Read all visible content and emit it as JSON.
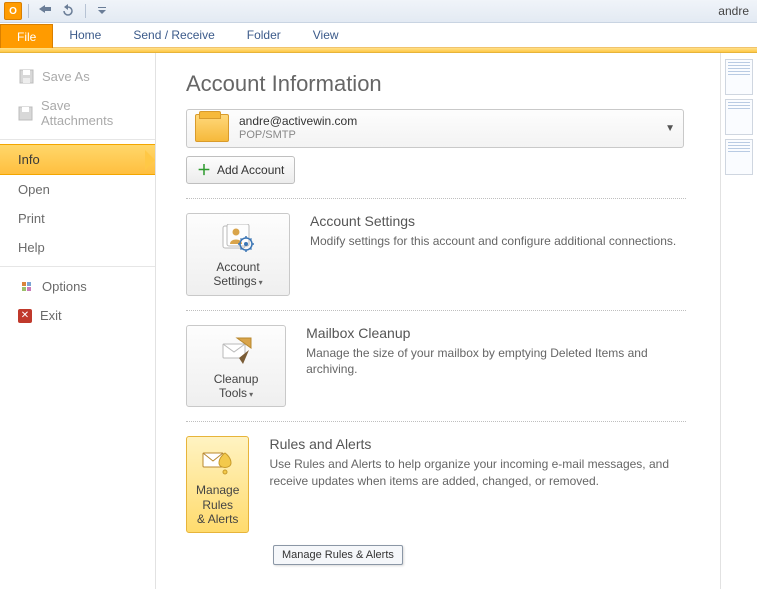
{
  "titlebar": {
    "right_text": "andre"
  },
  "ribbon": {
    "file": "File",
    "tabs": [
      "Home",
      "Send / Receive",
      "Folder",
      "View"
    ]
  },
  "backstage": {
    "save_as": "Save As",
    "save_attachments": "Save Attachments",
    "info": "Info",
    "open": "Open",
    "print": "Print",
    "help": "Help",
    "options": "Options",
    "exit": "Exit"
  },
  "main": {
    "heading": "Account Information",
    "account": {
      "email": "andre@activewin.com",
      "protocol": "POP/SMTP"
    },
    "add_account": "Add Account",
    "sections": {
      "settings": {
        "button_l1": "Account",
        "button_l2": "Settings",
        "title": "Account Settings",
        "body": "Modify settings for this account and configure additional connections."
      },
      "cleanup": {
        "button_l1": "Cleanup",
        "button_l2": "Tools",
        "title": "Mailbox Cleanup",
        "body": "Manage the size of your mailbox by emptying Deleted Items and archiving."
      },
      "rules": {
        "button_l1": "Manage Rules",
        "button_l2": "& Alerts",
        "title": "Rules and Alerts",
        "body": "Use Rules and Alerts to help organize your incoming e-mail messages, and receive updates when items are added, changed, or removed."
      }
    },
    "tooltip": "Manage Rules & Alerts"
  }
}
